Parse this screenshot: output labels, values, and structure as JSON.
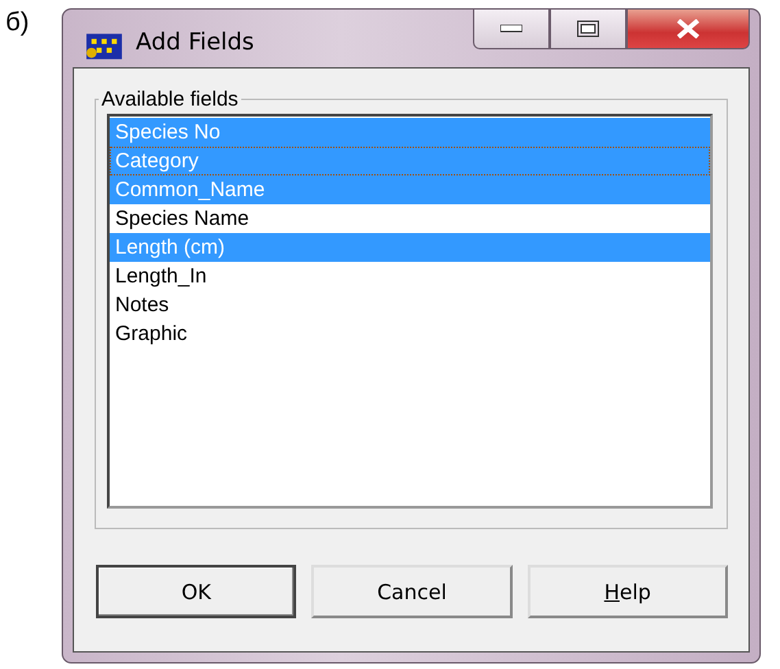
{
  "figure_label": "б)",
  "window": {
    "title": "Add Fields"
  },
  "group": {
    "label": "Available fields"
  },
  "fields": [
    {
      "name": "Species No",
      "selected": true,
      "focused": false
    },
    {
      "name": "Category",
      "selected": true,
      "focused": true
    },
    {
      "name": "Common_Name",
      "selected": true,
      "focused": false
    },
    {
      "name": "Species Name",
      "selected": false,
      "focused": false
    },
    {
      "name": "Length (cm)",
      "selected": true,
      "focused": false
    },
    {
      "name": "Length_In",
      "selected": false,
      "focused": false
    },
    {
      "name": "Notes",
      "selected": false,
      "focused": false
    },
    {
      "name": "Graphic",
      "selected": false,
      "focused": false
    }
  ],
  "buttons": [
    {
      "label": "OK",
      "default": true
    },
    {
      "label": "Cancel",
      "default": false
    },
    {
      "label": "Help",
      "default": false,
      "mnemonic": true
    }
  ]
}
